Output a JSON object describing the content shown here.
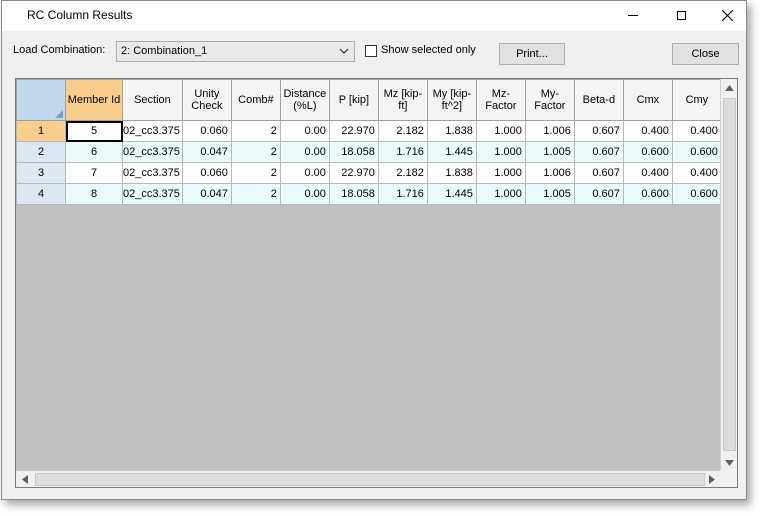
{
  "window": {
    "title": "RC Column Results"
  },
  "toolbar": {
    "load_combination_label": "Load Combination:",
    "load_combination_value": "2: Combination_1",
    "show_selected_label": "Show selected only",
    "print_label": "Print...",
    "close_label": "Close"
  },
  "table": {
    "headers": [
      "Member Id",
      "Section",
      "Unity Check",
      "Comb#",
      "Distance (%L)",
      "P [kip]",
      "Mz [kip-ft]",
      "My [kip-ft^2]",
      "Mz-Factor",
      "My-Factor",
      "Beta-d",
      "Cmx",
      "Cmy"
    ],
    "rows": [
      {
        "row": "1",
        "cells": [
          "5",
          "02_cc3.375",
          "0.060",
          "2",
          "0.00",
          "22.970",
          "2.182",
          "1.838",
          "1.000",
          "1.006",
          "0.607",
          "0.400",
          "0.400"
        ]
      },
      {
        "row": "2",
        "cells": [
          "6",
          "02_cc3.375",
          "0.047",
          "2",
          "0.00",
          "18.058",
          "1.716",
          "1.445",
          "1.000",
          "1.005",
          "0.607",
          "0.600",
          "0.600"
        ]
      },
      {
        "row": "3",
        "cells": [
          "7",
          "02_cc3.375",
          "0.060",
          "2",
          "0.00",
          "22.970",
          "2.182",
          "1.838",
          "1.000",
          "1.006",
          "0.607",
          "0.400",
          "0.400"
        ]
      },
      {
        "row": "4",
        "cells": [
          "8",
          "02_cc3.375",
          "0.047",
          "2",
          "0.00",
          "18.058",
          "1.716",
          "1.445",
          "1.000",
          "1.005",
          "0.607",
          "0.600",
          "0.600"
        ]
      }
    ]
  }
}
